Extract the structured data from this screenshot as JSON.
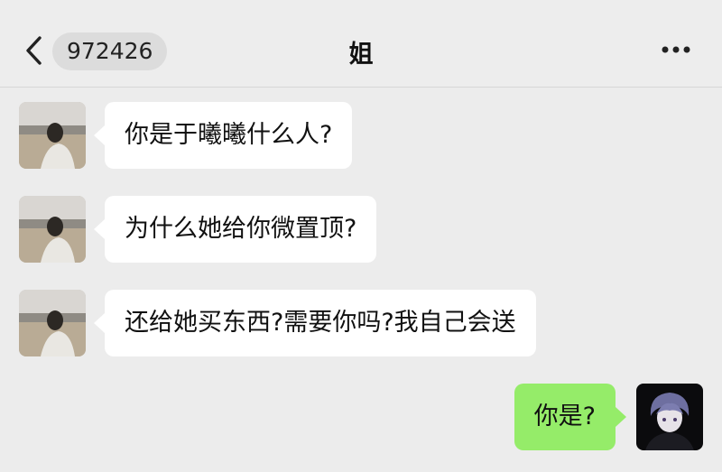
{
  "header": {
    "unread_count": "972426",
    "title": "姐",
    "back_icon": "chevron-left-icon",
    "more_icon": "more-dots-icon"
  },
  "messages": [
    {
      "from": "contact",
      "text": "你是于曦曦什么人?"
    },
    {
      "from": "contact",
      "text": "为什么她给你微置顶?"
    },
    {
      "from": "contact",
      "text": "还给她买东西?需要你吗?我自己会送"
    },
    {
      "from": "self",
      "text": "你是?"
    }
  ],
  "colors": {
    "background": "#ededed",
    "incoming_bubble": "#ffffff",
    "outgoing_bubble": "#95ec69"
  }
}
